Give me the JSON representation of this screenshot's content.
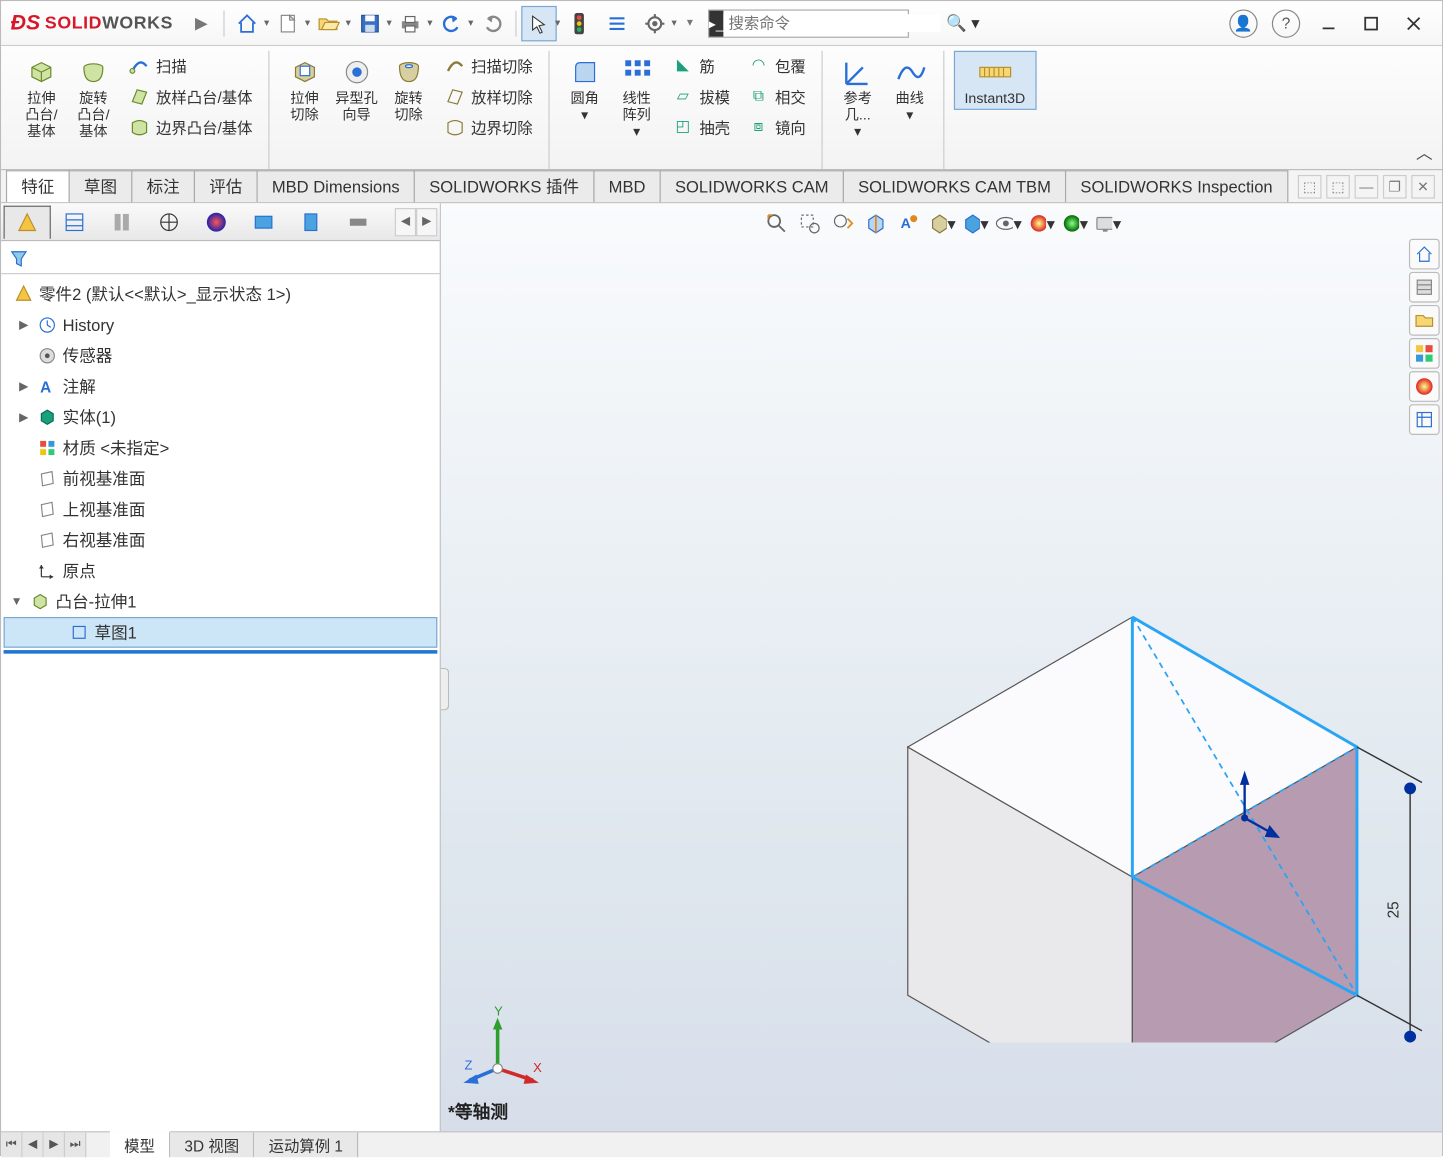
{
  "app": {
    "logo_text_1": "SOLID",
    "logo_text_2": "WORKS"
  },
  "search": {
    "placeholder": "搜索命令"
  },
  "ribbon": {
    "g1": {
      "extrude": "拉伸\n凸台/\n基体",
      "revolve": "旋转\n凸台/\n基体",
      "sweep": "扫描",
      "loft": "放样凸台/基体",
      "boundary": "边界凸台/基体"
    },
    "g2": {
      "cut_extrude": "拉伸\n切除",
      "hole_wizard": "异型孔\n向导",
      "cut_revolve": "旋转\n切除",
      "sweep_cut": "扫描切除",
      "loft_cut": "放样切除",
      "boundary_cut": "边界切除"
    },
    "g3": {
      "fillet": "圆角",
      "linear_pattern": "线性\n阵列",
      "rib": "筋",
      "draft": "拔模",
      "shell": "抽壳",
      "wrap": "包覆",
      "intersect": "相交",
      "mirror": "镜向"
    },
    "g4": {
      "ref_geom": "参考\n几...",
      "curves": "曲线"
    },
    "g5": {
      "instant3d": "Instant3D"
    }
  },
  "tabs": [
    "特征",
    "草图",
    "标注",
    "评估",
    "MBD Dimensions",
    "SOLIDWORKS 插件",
    "MBD",
    "SOLIDWORKS CAM",
    "SOLIDWORKS CAM TBM",
    "SOLIDWORKS Inspection"
  ],
  "tree": {
    "root": "零件2  (默认<<默认>_显示状态 1>)",
    "items": [
      {
        "label": "History",
        "expandable": true
      },
      {
        "label": "传感器",
        "expandable": false
      },
      {
        "label": "注解",
        "expandable": true
      },
      {
        "label": "实体(1)",
        "expandable": true
      },
      {
        "label": "材质 <未指定>",
        "expandable": false
      },
      {
        "label": "前视基准面",
        "expandable": false
      },
      {
        "label": "上视基准面",
        "expandable": false
      },
      {
        "label": "右视基准面",
        "expandable": false
      },
      {
        "label": "原点",
        "expandable": false
      }
    ],
    "feature": "凸台-拉伸1",
    "sketch": "草图1"
  },
  "viewport": {
    "label": "*等轴测",
    "dimension": "25"
  },
  "bottom_tabs": [
    "模型",
    "3D 视图",
    "运动算例 1"
  ]
}
